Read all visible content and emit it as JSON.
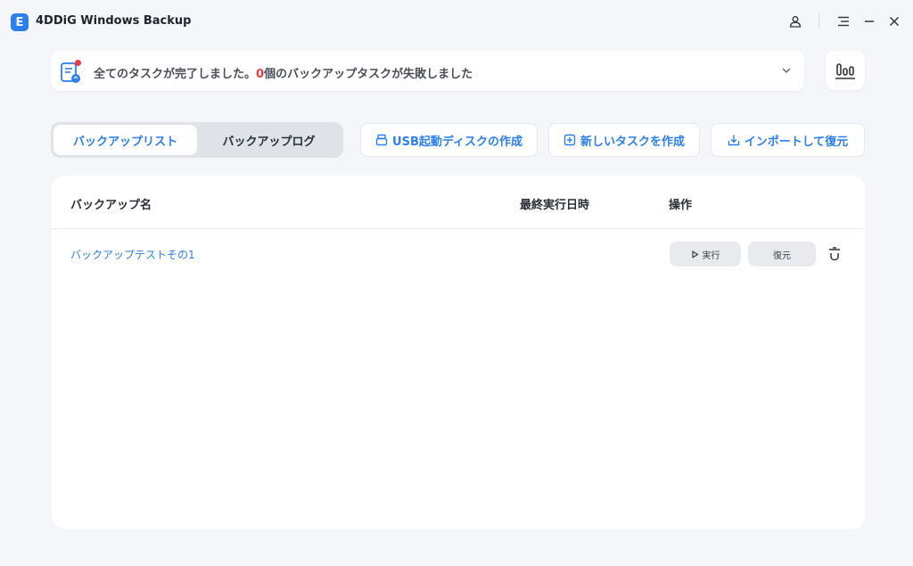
{
  "app": {
    "logo_letter": "E",
    "title": "4DDiG Windows Backup"
  },
  "titlebar": {
    "icons": [
      "user-icon",
      "menu-icon",
      "minimize-icon",
      "close-icon"
    ]
  },
  "banner": {
    "text_prefix": "全てのタスクが完了しました。",
    "fail_count": "0",
    "text_suffix": "個のバックアップタスクが失敗しました"
  },
  "tabs": [
    {
      "label": "バックアップリスト",
      "active": true
    },
    {
      "label": "バックアップログ",
      "active": false
    }
  ],
  "actions": {
    "usb_label": "USB起動ディスクの作成",
    "new_task_label": "新しいタスクを作成",
    "import_label": "インポートして復元"
  },
  "table": {
    "headers": {
      "name": "バックアップ名",
      "last_run": "最終実行日時",
      "operations": "操作"
    },
    "rows": [
      {
        "name": "バックアップテストその1",
        "last_run": "",
        "run_label": "実行",
        "restore_label": "復元"
      }
    ]
  },
  "colors": {
    "accent": "#2b7ff0",
    "fail": "#ef3b3b",
    "background": "#f4f6fa"
  }
}
